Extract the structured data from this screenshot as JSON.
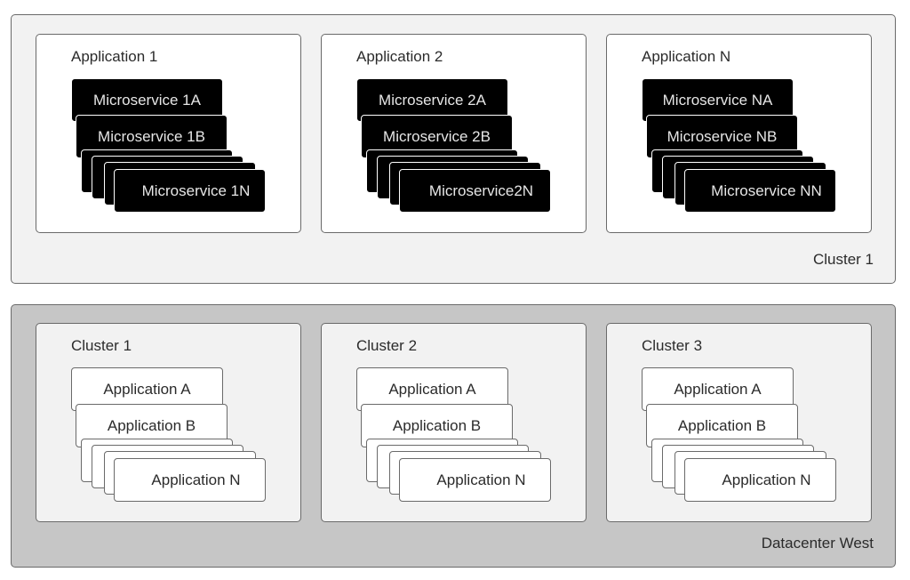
{
  "top_panel": {
    "label": "Cluster 1",
    "applications": [
      {
        "title": "Application 1",
        "cards": [
          "Microservice 1A",
          "Microservice 1B",
          "Microservice 1N"
        ]
      },
      {
        "title": "Application 2",
        "cards": [
          "Microservice 2A",
          "Microservice 2B",
          "Microservice2N"
        ]
      },
      {
        "title": "Application N",
        "cards": [
          "Microservice NA",
          "Microservice NB",
          "Microservice NN"
        ]
      }
    ]
  },
  "bottom_panel": {
    "label": "Datacenter West",
    "clusters": [
      {
        "title": "Cluster 1",
        "cards": [
          "Application A",
          "Application B",
          "Application N"
        ]
      },
      {
        "title": "Cluster 2",
        "cards": [
          "Application A",
          "Application B",
          "Application N"
        ]
      },
      {
        "title": "Cluster 3",
        "cards": [
          "Application A",
          "Application B",
          "Application N"
        ]
      }
    ]
  },
  "colors": {
    "top_panel_bg": "#f2f2f2",
    "bottom_panel_bg": "#c6c6c6",
    "microservice_card": "#000000",
    "application_card": "#ffffff",
    "border": "#6a6a6a"
  }
}
